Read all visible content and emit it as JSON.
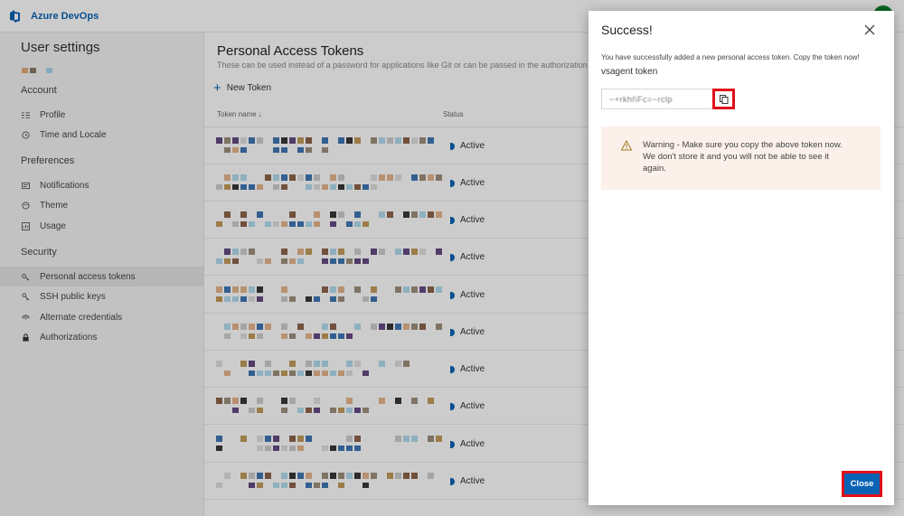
{
  "app": {
    "brand": "Azure DevOps"
  },
  "sidebar": {
    "title": "User settings",
    "sections": [
      {
        "title": "Account",
        "items": [
          {
            "label": "Profile",
            "icon": "profile-icon"
          },
          {
            "label": "Time and Locale",
            "icon": "clock-icon"
          }
        ]
      },
      {
        "title": "Preferences",
        "items": [
          {
            "label": "Notifications",
            "icon": "notification-icon"
          },
          {
            "label": "Theme",
            "icon": "theme-icon"
          },
          {
            "label": "Usage",
            "icon": "usage-icon"
          }
        ]
      },
      {
        "title": "Security",
        "items": [
          {
            "label": "Personal access tokens",
            "icon": "key-icon",
            "selected": true
          },
          {
            "label": "SSH public keys",
            "icon": "ssh-key-icon"
          },
          {
            "label": "Alternate credentials",
            "icon": "credentials-icon"
          },
          {
            "label": "Authorizations",
            "icon": "lock-icon"
          }
        ]
      }
    ]
  },
  "main": {
    "title": "Personal Access Tokens",
    "subtitle": "These can be used instead of a password for applications like Git or can be passed in the authorization header",
    "new_token": "New Token",
    "col_token": "Token name ↓",
    "col_status": "Status",
    "rows": [
      {
        "status": "Active"
      },
      {
        "status": "Active"
      },
      {
        "status": "Active"
      },
      {
        "status": "Active"
      },
      {
        "status": "Active"
      },
      {
        "status": "Active"
      },
      {
        "status": "Active"
      },
      {
        "status": "Active"
      },
      {
        "status": "Active"
      },
      {
        "status": "Active"
      }
    ]
  },
  "dialog": {
    "title": "Success!",
    "message": "You have successfully added a new personal access token. Copy the token now!",
    "token_name": "vsagent token",
    "token_value": "~+rkhl\\Fc=~rclp",
    "warning_l1": "Warning - Make sure you copy the above token now.",
    "warning_l2": "We don't store it and you will not be able to see it",
    "warning_l3": "again.",
    "close": "Close"
  },
  "colors": {
    "accent": "#0a63b4",
    "highlight": "#e0101a",
    "warning_bg": "#fbf0ea"
  }
}
